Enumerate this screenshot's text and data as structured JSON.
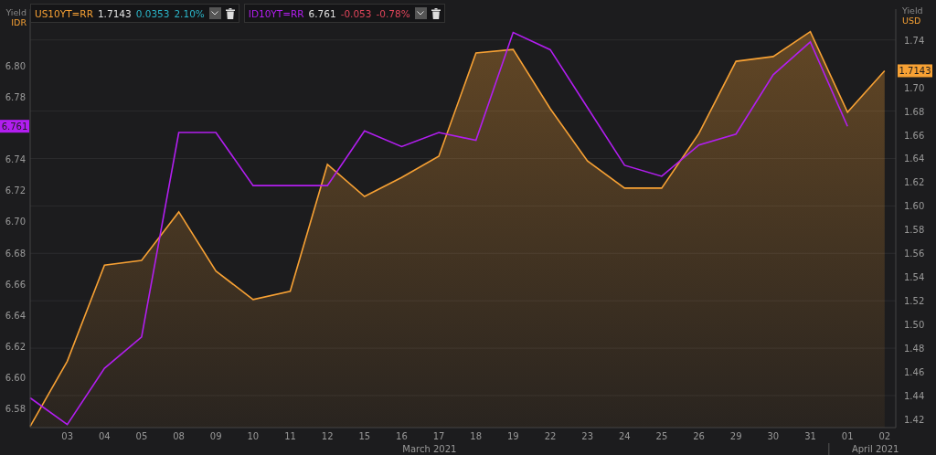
{
  "axes": {
    "left": {
      "title": "Yield",
      "unit": "IDR"
    },
    "right": {
      "title": "Yield",
      "unit": "USD"
    }
  },
  "legend": [
    {
      "last": "1.7143",
      "change": "0.0353",
      "change_pct": "2.10%",
      "color": "#2bb5c9"
    },
    {
      "last": "6.761",
      "change": "-0.053",
      "change_pct": "-0.78%",
      "color": "#e0455a"
    }
  ],
  "chart_data": {
    "type": "line",
    "grid": true,
    "categories": [
      null,
      "03",
      "04",
      "05",
      "08",
      "09",
      "10",
      "11",
      "12",
      "15",
      "16",
      "17",
      "18",
      "19",
      "22",
      "23",
      "24",
      "25",
      "26",
      "29",
      "30",
      "31",
      "01",
      "02"
    ],
    "ylim": [
      6.568,
      6.836
    ],
    "yticks": [
      {
        "value": 6.58,
        "label": "6.58"
      },
      {
        "value": 6.6,
        "label": "6.60"
      },
      {
        "value": 6.62,
        "label": "6.62"
      },
      {
        "value": 6.64,
        "label": "6.64"
      },
      {
        "value": 6.66,
        "label": "6.66"
      },
      {
        "value": 6.68,
        "label": "6.68"
      },
      {
        "value": 6.7,
        "label": "6.70"
      },
      {
        "value": 6.72,
        "label": "6.72"
      },
      {
        "value": 6.74,
        "label": "6.74"
      },
      {
        "value": 6.78,
        "label": "6.78"
      },
      {
        "value": 6.8,
        "label": "6.80"
      }
    ],
    "y2lim": [
      1.413,
      1.766
    ],
    "y2ticks": [
      {
        "value": 1.42,
        "label": "1.42"
      },
      {
        "value": 1.44,
        "label": "1.44"
      },
      {
        "value": 1.46,
        "label": "1.46"
      },
      {
        "value": 1.48,
        "label": "1.48"
      },
      {
        "value": 1.5,
        "label": "1.50"
      },
      {
        "value": 1.52,
        "label": "1.52"
      },
      {
        "value": 1.54,
        "label": "1.54"
      },
      {
        "value": 1.56,
        "label": "1.56"
      },
      {
        "value": 1.58,
        "label": "1.58"
      },
      {
        "value": 1.6,
        "label": "1.60"
      },
      {
        "value": 1.62,
        "label": "1.62"
      },
      {
        "value": 1.64,
        "label": "1.64"
      },
      {
        "value": 1.66,
        "label": "1.66"
      },
      {
        "value": 1.68,
        "label": "1.68"
      },
      {
        "value": 1.7,
        "label": "1.70"
      },
      {
        "value": 1.74,
        "label": "1.74"
      }
    ],
    "series": [
      {
        "name": "US10YT=RR",
        "color": "#f7a134",
        "axis": "y2",
        "type": "area",
        "values": [
          1.414,
          1.469,
          1.55,
          1.554,
          1.595,
          1.545,
          1.521,
          1.528,
          1.635,
          1.608,
          1.624,
          1.642,
          1.729,
          1.732,
          1.682,
          1.638,
          1.615,
          1.615,
          1.661,
          1.722,
          1.726,
          1.747,
          1.679,
          1.714
        ]
      },
      {
        "name": "ID10YT=RR",
        "color": "#b21ef0",
        "values": [
          6.587,
          6.57,
          6.606,
          6.626,
          6.757,
          6.757,
          6.723,
          6.723,
          6.723,
          6.758,
          6.748,
          6.757,
          6.752,
          6.821,
          6.81,
          6.773,
          6.736,
          6.729,
          6.749,
          6.756,
          6.794,
          6.815,
          6.761,
          null
        ]
      }
    ]
  },
  "value_badges": [
    {
      "label": "1.7143"
    },
    {
      "label": "6.761"
    }
  ],
  "x_axis_groups": [
    {
      "label": "March 2021"
    },
    {
      "label": "April 2021"
    }
  ]
}
